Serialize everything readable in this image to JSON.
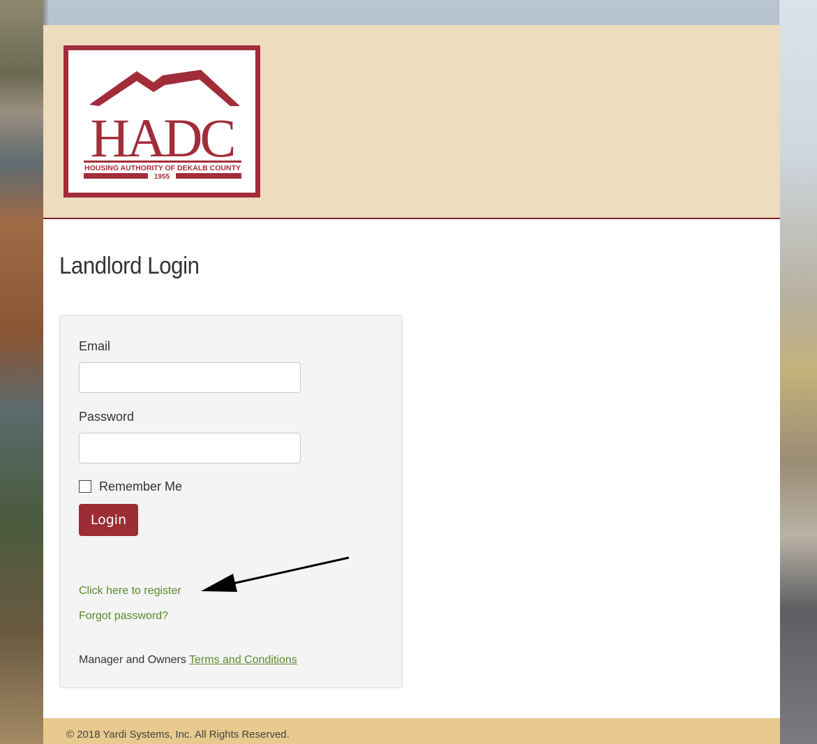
{
  "header": {
    "logo": {
      "acronym": "HADC",
      "subtitle": "HOUSING AUTHORITY OF DEKALB COUNTY",
      "year": "1955"
    }
  },
  "main": {
    "title": "Landlord Login"
  },
  "form": {
    "email_label": "Email",
    "email_value": "",
    "password_label": "Password",
    "password_value": "",
    "remember_label": "Remember Me",
    "remember_checked": false,
    "login_button": "Login"
  },
  "links": {
    "register": "Click here to register",
    "forgot": "Forgot password?",
    "terms_prefix": "Manager and Owners ",
    "terms_link": "Terms and Conditions"
  },
  "footer": {
    "copyright": "© 2018 Yardi Systems, Inc. All Rights Reserved."
  },
  "colors": {
    "brand": "#9c2d35",
    "header_bg": "#eddcbd",
    "footer_bg": "#e8c98e",
    "link": "#5a8a28"
  }
}
